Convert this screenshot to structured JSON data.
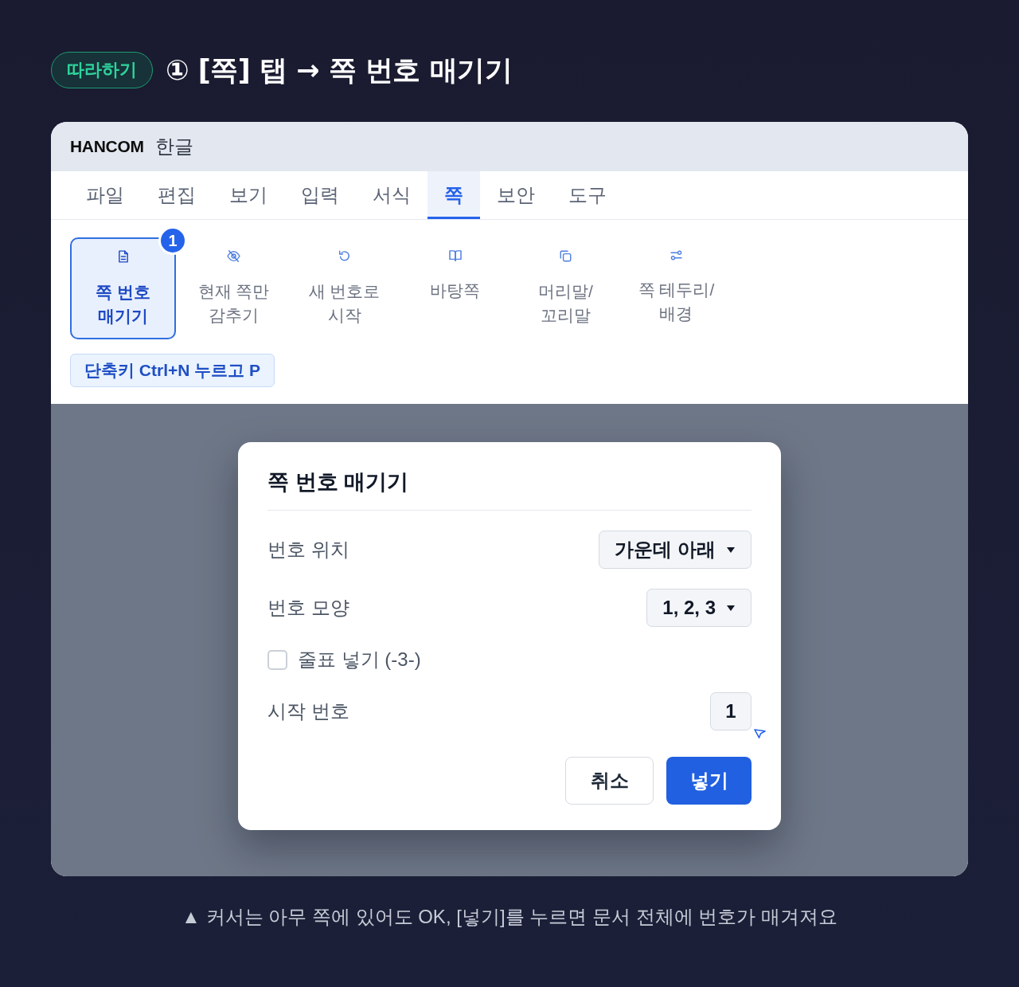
{
  "header": {
    "badge": "따라하기",
    "title": "① [쪽] 탭 → 쪽 번호 매기기"
  },
  "window": {
    "logo": "HANCOM",
    "app_name": "한글",
    "tabs": [
      {
        "label": "파일",
        "selected": false
      },
      {
        "label": "편집",
        "selected": false
      },
      {
        "label": "보기",
        "selected": false
      },
      {
        "label": "입력",
        "selected": false
      },
      {
        "label": "서식",
        "selected": false
      },
      {
        "label": "쪽",
        "selected": true
      },
      {
        "label": "보안",
        "selected": false
      },
      {
        "label": "도구",
        "selected": false
      }
    ],
    "ribbon": {
      "items": [
        {
          "lines": [
            "쪽 번호",
            "매기기"
          ],
          "selected": true,
          "badge": "1"
        },
        {
          "lines": [
            "현재 쪽만",
            "감추기"
          ],
          "selected": false
        },
        {
          "lines": [
            "새 번호로",
            "시작"
          ],
          "selected": false
        },
        {
          "lines": [
            "바탕쪽"
          ],
          "selected": false
        },
        {
          "lines": [
            "머리말/",
            "꼬리말"
          ],
          "selected": false
        },
        {
          "lines": [
            "쪽 테두리/",
            "배경"
          ],
          "selected": false
        }
      ]
    },
    "shortcut_hint": "단축키 Ctrl+N 누르고 P"
  },
  "dialog": {
    "title": "쪽 번호 매기기",
    "fields": [
      {
        "kind": "dropdown",
        "label": "번호 위치",
        "value": "가운데 아래"
      },
      {
        "kind": "dropdown",
        "label": "번호 모양",
        "value": "1, 2, 3"
      },
      {
        "kind": "checkbox",
        "label": "줄표 넣기 (-3-)",
        "checked": false
      },
      {
        "kind": "number",
        "label": "시작 번호",
        "value": "1"
      }
    ],
    "buttons": [
      {
        "kind": "secondary",
        "label": "취소"
      },
      {
        "kind": "primary",
        "label": "넣기"
      }
    ]
  },
  "caption": "▲ 커서는 아무 쪽에 있어도 OK, [넣기]를 누르면 문서 전체에 번호가 매겨져요"
}
